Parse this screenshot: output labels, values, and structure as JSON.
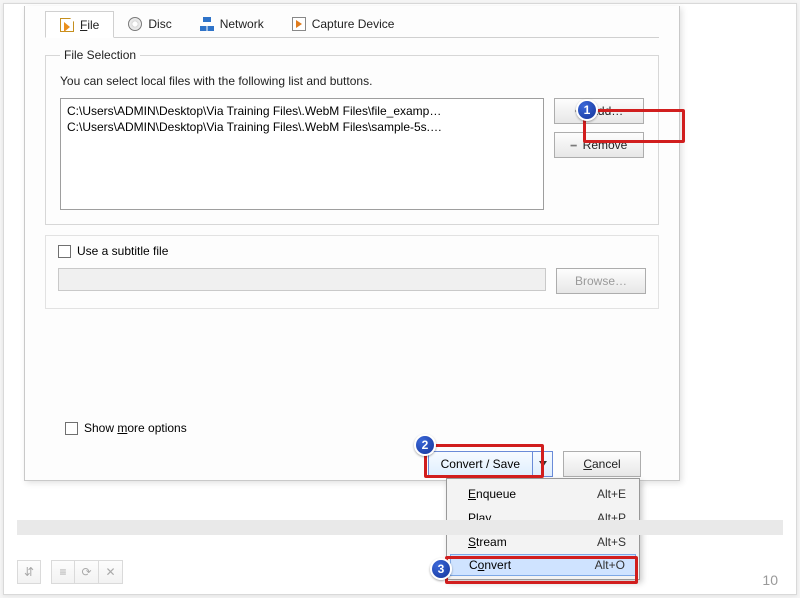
{
  "tabs": {
    "file": "File",
    "disc": "Disc",
    "network": "Network",
    "capture": "Capture Device"
  },
  "fileSelection": {
    "legend": "File Selection",
    "hint": "You can select local files with the following list and buttons.",
    "items": [
      "C:\\Users\\ADMIN\\Desktop\\Via Training Files\\.WebM Files\\file_examp…",
      "C:\\Users\\ADMIN\\Desktop\\Via Training Files\\.WebM Files\\sample-5s.…"
    ],
    "addLabel": "Add…",
    "removeLabel": "Remove"
  },
  "subtitle": {
    "checkboxLabel": "Use a subtitle file",
    "browseLabel": "Browse…"
  },
  "moreOptionsLabel": "Show more options",
  "footer": {
    "convertSave": "Convert / Save",
    "cancel": "Cancel"
  },
  "menu": {
    "enqueue": {
      "label": "Enqueue",
      "accel": "Alt+E"
    },
    "play": {
      "label": "Play",
      "accel": "Alt+P"
    },
    "stream": {
      "label": "Stream",
      "accel": "Alt+S"
    },
    "convert": {
      "label": "Convert",
      "accel": "Alt+O"
    }
  },
  "badges": {
    "b1": "1",
    "b2": "2",
    "b3": "3"
  },
  "pageNumber": "10"
}
